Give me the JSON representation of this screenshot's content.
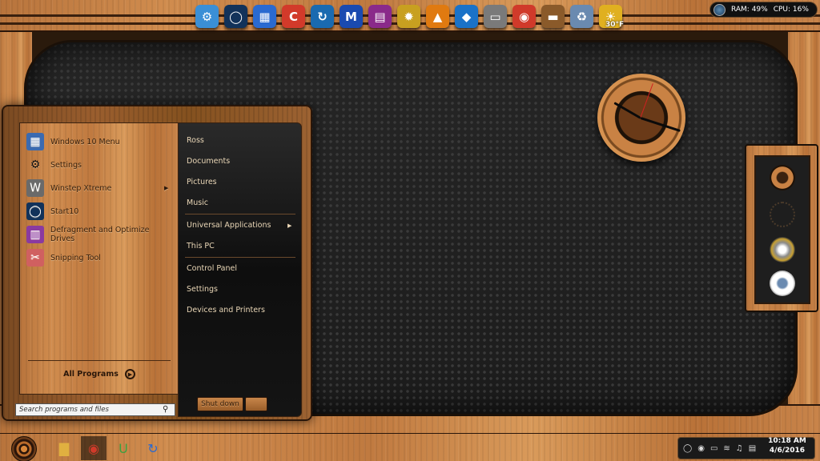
{
  "system_meters": {
    "ram": "RAM: 49%",
    "cpu": "CPU: 16%"
  },
  "dock": {
    "icons": [
      {
        "name": "control-panel-icon",
        "glyph": "⚙",
        "color": "#3a8fd6"
      },
      {
        "name": "start10-icon",
        "glyph": "◯",
        "color": "#12325a"
      },
      {
        "name": "winstep-icon",
        "glyph": "▦",
        "color": "#2a6ad0"
      },
      {
        "name": "ccleaner-icon",
        "glyph": "C",
        "color": "#d23a2a"
      },
      {
        "name": "iobit-updater-icon",
        "glyph": "↻",
        "color": "#1a6ab0"
      },
      {
        "name": "malwarebytes-icon",
        "glyph": "M",
        "color": "#1a4ab0"
      },
      {
        "name": "winrar-icon",
        "glyph": "▤",
        "color": "#8a2a8a"
      },
      {
        "name": "deskpins-icon",
        "glyph": "✹",
        "color": "#c8a020"
      },
      {
        "name": "vlc-icon",
        "glyph": "▲",
        "color": "#e07a10"
      },
      {
        "name": "teamviewer-icon",
        "glyph": "◆",
        "color": "#1a72c8"
      },
      {
        "name": "drive-icon",
        "glyph": "▭",
        "color": "#7a7a7a"
      },
      {
        "name": "chrome-icon",
        "glyph": "◉",
        "color": "#d03a2a"
      },
      {
        "name": "folder-icon",
        "glyph": "▬",
        "color": "#8a5a2a"
      },
      {
        "name": "recycle-bin-icon",
        "glyph": "♻",
        "color": "#6a8ab0"
      },
      {
        "name": "weather-icon",
        "glyph": "☀",
        "color": "#e0b020"
      }
    ],
    "weather_label": "30°F"
  },
  "start_menu": {
    "programs": [
      {
        "label": "Windows 10 Menu",
        "icon": "windows-menu-icon",
        "glyph": "▦",
        "color": "#3a6ab0",
        "has_submenu": false
      },
      {
        "label": "Settings",
        "icon": "gear-icon",
        "glyph": "⚙",
        "color": "transparent",
        "has_submenu": false
      },
      {
        "label": "Winstep Xtreme",
        "icon": "winstep-xtreme-icon",
        "glyph": "W",
        "color": "#6a6a6a",
        "has_submenu": true
      },
      {
        "label": "Start10",
        "icon": "start10-icon",
        "glyph": "◯",
        "color": "#12325a",
        "has_submenu": false
      },
      {
        "label": "Defragment and Optimize Drives",
        "icon": "defrag-icon",
        "glyph": "▥",
        "color": "#8a3aa0",
        "has_submenu": false
      },
      {
        "label": "Snipping Tool",
        "icon": "scissors-icon",
        "glyph": "✂",
        "color": "#d06060",
        "has_submenu": false
      }
    ],
    "all_programs": "All Programs",
    "places": [
      {
        "label": "Ross",
        "sep_after": false,
        "has_submenu": false
      },
      {
        "label": "Documents",
        "sep_after": false,
        "has_submenu": false
      },
      {
        "label": "Pictures",
        "sep_after": false,
        "has_submenu": false
      },
      {
        "label": "Music",
        "sep_after": true,
        "has_submenu": false
      },
      {
        "label": "Universal Applications",
        "sep_after": false,
        "has_submenu": true
      },
      {
        "label": "This PC",
        "sep_after": true,
        "has_submenu": false
      },
      {
        "label": "Control Panel",
        "sep_after": false,
        "has_submenu": false
      },
      {
        "label": "Settings",
        "sep_after": false,
        "has_submenu": false
      },
      {
        "label": "Devices and Printers",
        "sep_after": false,
        "has_submenu": false
      }
    ],
    "search_placeholder": "Search programs and files",
    "shutdown_label": "Shut down"
  },
  "taskbar": {
    "buttons": [
      {
        "name": "file-explorer-icon",
        "glyph": "▇",
        "color": "#e0b040"
      },
      {
        "name": "chrome-icon",
        "glyph": "◉",
        "color": "#d03a2a"
      },
      {
        "name": "uniblue-icon",
        "glyph": "U",
        "color": "#3aa040"
      },
      {
        "name": "iobit-icon",
        "glyph": "↻",
        "color": "#2a6ad0"
      }
    ],
    "tray_icons": [
      "start10-tray-icon",
      "record-icon",
      "battery-icon",
      "wifi-icon",
      "volume-icon",
      "notifications-icon"
    ],
    "time": "10:18 AM",
    "date": "4/6/2016"
  }
}
